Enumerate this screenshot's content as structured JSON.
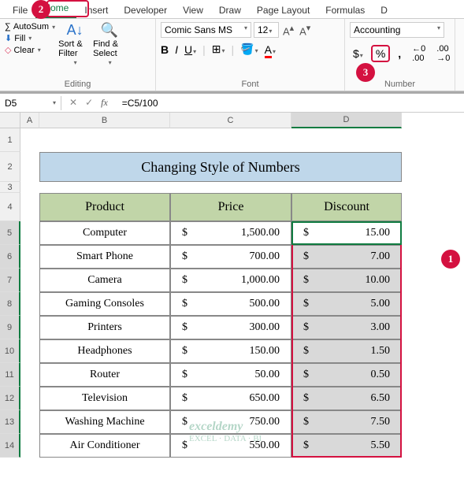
{
  "tabs": [
    "File",
    "Home",
    "Insert",
    "Developer",
    "View",
    "Draw",
    "Page Layout",
    "Formulas",
    "D"
  ],
  "active_tab": "Home",
  "ribbon": {
    "editing": {
      "autosum": "AutoSum",
      "fill": "Fill",
      "clear": "Clear",
      "sort": "Sort & Filter",
      "find": "Find & Select",
      "label": "Editing"
    },
    "font": {
      "name": "Comic Sans MS",
      "size": "12",
      "label": "Font"
    },
    "number": {
      "format": "Accounting",
      "label": "Number"
    }
  },
  "name_box": "D5",
  "formula": "=C5/100",
  "columns": [
    "A",
    "B",
    "C",
    "D"
  ],
  "title": "Changing Style of Numbers",
  "headers": {
    "product": "Product",
    "price": "Price",
    "discount": "Discount"
  },
  "rows": [
    {
      "product": "Computer",
      "price": "1,500.00",
      "discount": "15.00"
    },
    {
      "product": "Smart Phone",
      "price": "700.00",
      "discount": "7.00"
    },
    {
      "product": "Camera",
      "price": "1,000.00",
      "discount": "10.00"
    },
    {
      "product": "Gaming Consoles",
      "price": "500.00",
      "discount": "5.00"
    },
    {
      "product": "Printers",
      "price": "300.00",
      "discount": "3.00"
    },
    {
      "product": "Headphones",
      "price": "150.00",
      "discount": "1.50"
    },
    {
      "product": "Router",
      "price": "50.00",
      "discount": "0.50"
    },
    {
      "product": "Television",
      "price": "650.00",
      "discount": "6.50"
    },
    {
      "product": "Washing Machine",
      "price": "750.00",
      "discount": "7.50"
    },
    {
      "product": "Air Conditioner",
      "price": "550.00",
      "discount": "5.50"
    }
  ],
  "currency": "$",
  "watermark": {
    "title": "exceldemy",
    "sub": "EXCEL · DATA · BI"
  },
  "callouts": {
    "c1": "1",
    "c2": "2",
    "c3": "3"
  }
}
